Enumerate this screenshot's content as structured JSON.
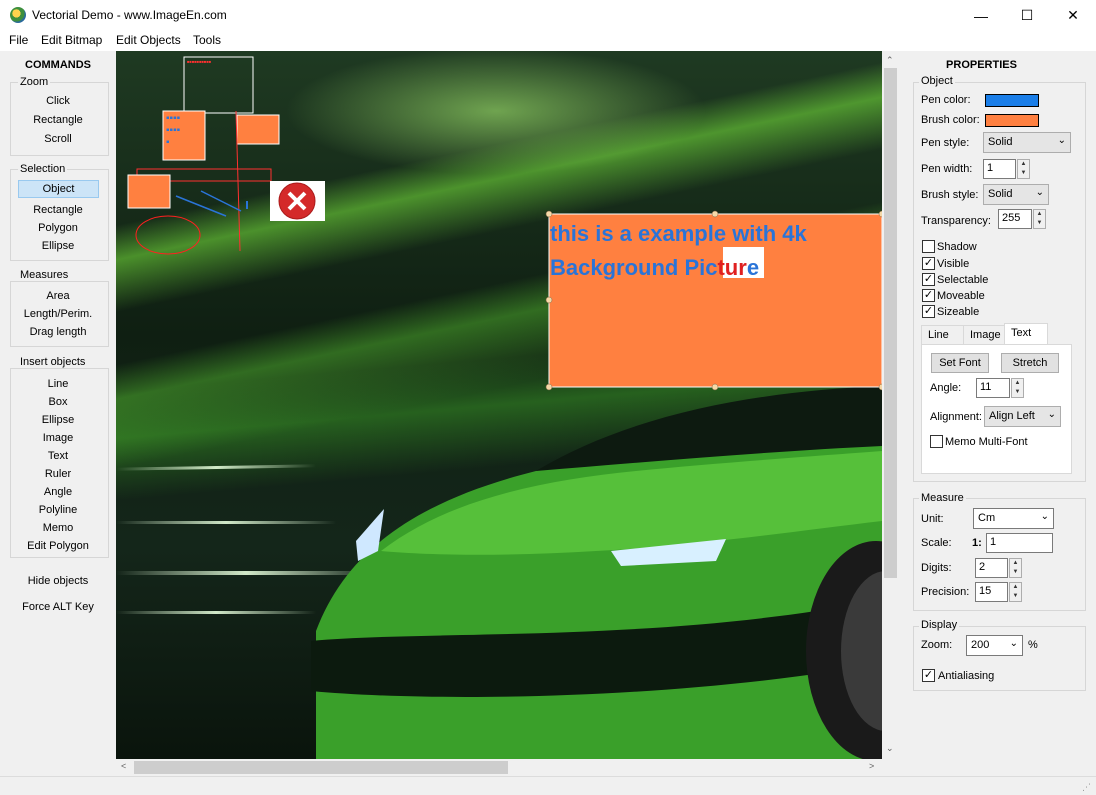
{
  "window": {
    "title": "Vectorial Demo - www.ImageEn.com",
    "minimize": "—",
    "maximize": "☐",
    "close": "✕"
  },
  "menu": [
    "File",
    "Edit Bitmap",
    "Edit Objects",
    "Tools"
  ],
  "commands": {
    "header": "COMMANDS",
    "zoom": {
      "label": "Zoom",
      "items": [
        "Click",
        "Rectangle",
        "Scroll"
      ]
    },
    "selection": {
      "label": "Selection",
      "items": [
        "Object",
        "Rectangle",
        "Polygon",
        "Ellipse"
      ]
    },
    "measures": {
      "label": "Measures",
      "items": [
        "Area",
        "Length/Perim.",
        "Drag length"
      ]
    },
    "insert": {
      "label": "Insert objects",
      "items": [
        "Line",
        "Box",
        "Ellipse",
        "Image",
        "Text",
        "Ruler",
        "Angle",
        "Polyline",
        "Memo",
        "Edit Polygon"
      ]
    },
    "hide": "Hide objects",
    "force_alt": "Force ALT Key"
  },
  "canvas": {
    "text_object": "this is a example with 4k Background Picture",
    "text_line1": "this is a example with 4k",
    "text_line2_a": "Background Pic",
    "text_line2_b": "tur",
    "text_line2_c": "e",
    "text_color": "#2a74d8",
    "box_color": "#ff8040"
  },
  "properties": {
    "header": "PROPERTIES",
    "object_label": "Object",
    "pen_color_label": "Pen color:",
    "pen_color": "#1a7ee8",
    "brush_color_label": "Brush color:",
    "brush_color": "#ff8040",
    "pen_style_label": "Pen style:",
    "pen_style": "Solid",
    "pen_width_label": "Pen width:",
    "pen_width": "1",
    "brush_style_label": "Brush style:",
    "brush_style": "Solid",
    "transparency_label": "Transparency:",
    "transparency": "255",
    "checkboxes": [
      {
        "label": "Shadow",
        "checked": false
      },
      {
        "label": "Visible",
        "checked": true
      },
      {
        "label": "Selectable",
        "checked": true
      },
      {
        "label": "Moveable",
        "checked": true
      },
      {
        "label": "Sizeable",
        "checked": true
      }
    ],
    "tabs": [
      "Line",
      "Image",
      "Text"
    ],
    "set_font": "Set Font",
    "stretch": "Stretch",
    "angle_label": "Angle:",
    "angle": "11",
    "alignment_label": "Alignment:",
    "alignment": "Align Left",
    "memo_multi_font": "Memo Multi-Font",
    "measure_label": "Measure",
    "unit_label": "Unit:",
    "unit": "Cm",
    "scale_label": "Scale:",
    "scale_prefix": "1:",
    "scale": "1",
    "digits_label": "Digits:",
    "digits": "2",
    "precision_label": "Precision:",
    "precision": "15",
    "display_label": "Display",
    "zoom_label": "Zoom:",
    "zoom": "200",
    "zoom_unit": "%",
    "antialiasing": "Antialiasing"
  }
}
